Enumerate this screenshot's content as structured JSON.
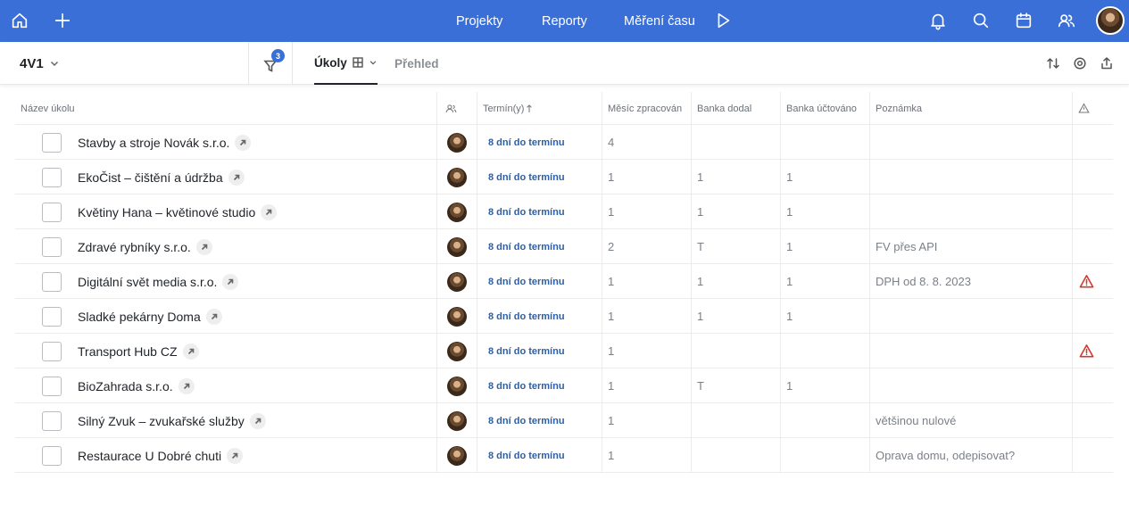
{
  "colors": {
    "brand": "#3a6fd8",
    "deadline": "#2b5fa8",
    "warning": "#d33a2c"
  },
  "topbar": {
    "left_icons": [
      "home-icon",
      "plus-icon"
    ],
    "nav": [
      {
        "label": "Projekty"
      },
      {
        "label": "Reporty"
      },
      {
        "label": "Měření času"
      }
    ],
    "play_icon": "play-icon",
    "right_icons": [
      "bell-icon",
      "search-icon",
      "calendar-icon",
      "users-icon"
    ]
  },
  "subbar": {
    "project": "4V1",
    "filter_count": "3",
    "tabs": [
      {
        "label": "Úkoly",
        "active": true
      },
      {
        "label": "Přehled",
        "active": false
      }
    ],
    "tools": [
      "sort-icon",
      "settings-icon",
      "export-icon"
    ]
  },
  "table": {
    "columns": {
      "name": "Název úkolu",
      "deadline": "Termín(y)",
      "month": "Měsíc zpracován",
      "bank_delivered": "Banka dodal",
      "bank_billed": "Banka účtováno",
      "note": "Poznámka"
    },
    "rows": [
      {
        "name": "Stavby a stroje Novák s.r.o.",
        "deadline": "8 dní do termínu",
        "month": "4",
        "bank_delivered": "",
        "bank_billed": "",
        "note": "",
        "warning": false
      },
      {
        "name": "EkoČist – čištění a údržba",
        "deadline": "8 dní do termínu",
        "month": "1",
        "bank_delivered": "1",
        "bank_billed": "1",
        "note": "",
        "warning": false
      },
      {
        "name": "Květiny Hana – květinové studio",
        "deadline": "8 dní do termínu",
        "month": "1",
        "bank_delivered": "1",
        "bank_billed": "1",
        "note": "",
        "warning": false
      },
      {
        "name": "Zdravé rybníky s.r.o.",
        "deadline": "8 dní do termínu",
        "month": "2",
        "bank_delivered": "T",
        "bank_billed": "1",
        "note": "FV přes API",
        "warning": false
      },
      {
        "name": "Digitální svět media s.r.o.",
        "deadline": "8 dní do termínu",
        "month": "1",
        "bank_delivered": "1",
        "bank_billed": "1",
        "note": "DPH od 8. 8. 2023",
        "warning": true
      },
      {
        "name": "Sladké pekárny Doma",
        "deadline": "8 dní do termínu",
        "month": "1",
        "bank_delivered": "1",
        "bank_billed": "1",
        "note": "",
        "warning": false
      },
      {
        "name": "Transport Hub CZ",
        "deadline": "8 dní do termínu",
        "month": "1",
        "bank_delivered": "",
        "bank_billed": "",
        "note": "",
        "warning": true
      },
      {
        "name": "BioZahrada s.r.o.",
        "deadline": "8 dní do termínu",
        "month": "1",
        "bank_delivered": "T",
        "bank_billed": "1",
        "note": "",
        "warning": false
      },
      {
        "name": "Silný Zvuk – zvukařské služby",
        "deadline": "8 dní do termínu",
        "month": "1",
        "bank_delivered": "",
        "bank_billed": "",
        "note": "většinou nulové",
        "warning": false
      },
      {
        "name": "Restaurace U Dobré chuti",
        "deadline": "8 dní do termínu",
        "month": "1",
        "bank_delivered": "",
        "bank_billed": "",
        "note": "Oprava domu, odepisovat?",
        "warning": false
      }
    ]
  }
}
